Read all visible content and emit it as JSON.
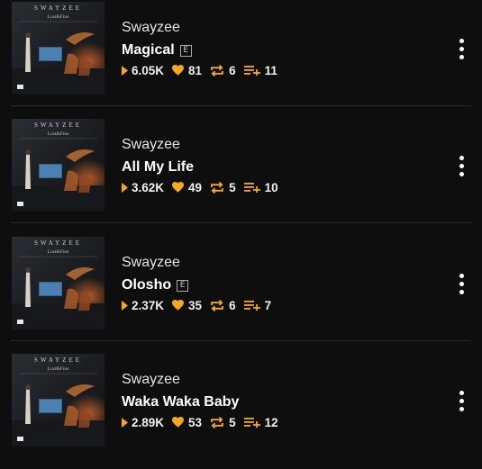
{
  "colors": {
    "background": "#0e0e0e",
    "accent_orange": "#f5a623",
    "divider": "#2a2a2a"
  },
  "tracks": [
    {
      "artist": "Swayzee",
      "title": "Magical",
      "explicit": true,
      "explicit_label": "E",
      "plays": "6.05K",
      "likes": "81",
      "reposts": "6",
      "playlist_adds": "11",
      "cover_text_top": "SWAYZEE",
      "cover_text_bottom": "Lost&Fine"
    },
    {
      "artist": "Swayzee",
      "title": "All My Life",
      "explicit": false,
      "explicit_label": "",
      "plays": "3.62K",
      "likes": "49",
      "reposts": "5",
      "playlist_adds": "10",
      "cover_text_top": "SWAYZEE",
      "cover_text_bottom": "Lost&Fine"
    },
    {
      "artist": "Swayzee",
      "title": "Olosho",
      "explicit": true,
      "explicit_label": "E",
      "plays": "2.37K",
      "likes": "35",
      "reposts": "6",
      "playlist_adds": "7",
      "cover_text_top": "SWAYZEE",
      "cover_text_bottom": "Lost&Fine"
    },
    {
      "artist": "Swayzee",
      "title": "Waka Waka Baby",
      "explicit": false,
      "explicit_label": "",
      "plays": "2.89K",
      "likes": "53",
      "reposts": "5",
      "playlist_adds": "12",
      "cover_text_top": "SWAYZEE",
      "cover_text_bottom": "Lost&Fine"
    }
  ],
  "icons": {
    "cover": "album-cover-art",
    "play": "play-triangle-icon",
    "like": "heart-icon",
    "repost": "repost-icon",
    "playlist_add": "playlist-add-icon",
    "more": "vertical-ellipsis-icon"
  }
}
